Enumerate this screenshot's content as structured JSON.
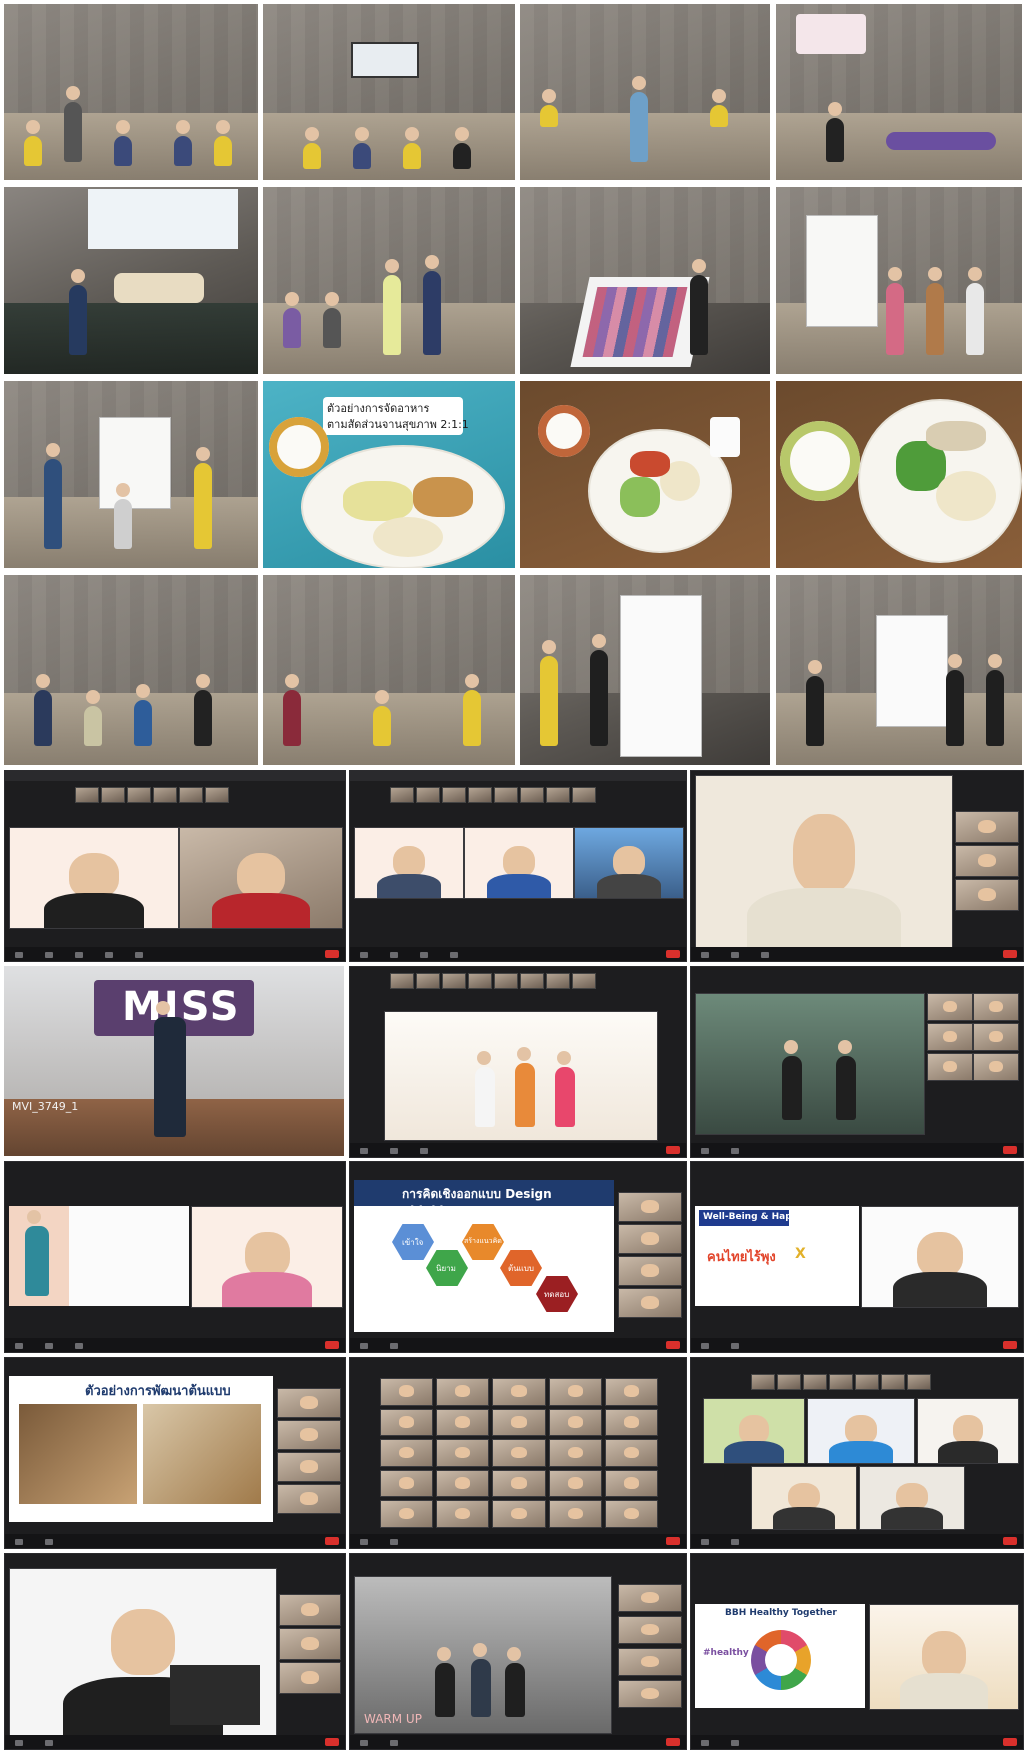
{
  "collage": {
    "photos": [
      {
        "id": "r1c1",
        "kind": "workshop-hall"
      },
      {
        "id": "r1c2",
        "kind": "workshop-hall-exercise"
      },
      {
        "id": "r1c3",
        "kind": "workshop-hall-stage"
      },
      {
        "id": "r1c4",
        "kind": "workshop-first-aid"
      },
      {
        "id": "r2c1",
        "kind": "presentation-stage"
      },
      {
        "id": "r2c2",
        "kind": "workshop-speakers"
      },
      {
        "id": "r2c3",
        "kind": "color-cards-table"
      },
      {
        "id": "r2c4",
        "kind": "flipchart-group"
      },
      {
        "id": "r3c1",
        "kind": "flipchart-group"
      },
      {
        "id": "r3c2",
        "kind": "food-plate-sign"
      },
      {
        "id": "r3c3",
        "kind": "food-plate"
      },
      {
        "id": "r3c4",
        "kind": "food-plate"
      },
      {
        "id": "r4c1",
        "kind": "discussion-circle"
      },
      {
        "id": "r4c2",
        "kind": "discussion-group"
      },
      {
        "id": "r4c3",
        "kind": "flipchart-writing"
      },
      {
        "id": "r4c4",
        "kind": "flipchart-presenting"
      }
    ],
    "food_sign": {
      "line1": "ตัวอย่างการจัดอาหาร",
      "line2": "ตามสัดส่วนจานสุขภาพ 2:1:1"
    },
    "video_calls": {
      "miss_banner": "MISS",
      "clip_label": "MVI_3749_1",
      "design_thinking_title": "การคิดเชิงออกแบบ Design Thinking",
      "design_thinking_steps": [
        "เข้าใจ",
        "นิยาม",
        "สร้างแนวคิด",
        "ต้นแบบ",
        "ทดสอบ"
      ],
      "prototype_title": "ตัวอย่างการพัฒนาต้นแบบ",
      "wellbeing_title": "Well-Being & Happy",
      "wellbeing_brand": "คนไทยไร้พุง",
      "wellbeing_x": "X",
      "warmup_label": "WARM UP",
      "healthy_title": "BBH Healthy Together",
      "healthy_center": "#healthy"
    },
    "colors": {
      "zoom_bg": "#1d1d1f",
      "leave_button": "#d9302c",
      "hex_blue": "#5b8fd6",
      "hex_green": "#3fa64a",
      "hex_orange": "#e8892b",
      "hex_orange2": "#e0652a",
      "hex_red": "#9b1f22",
      "miss_banner_bg": "#5a3f6e"
    }
  }
}
